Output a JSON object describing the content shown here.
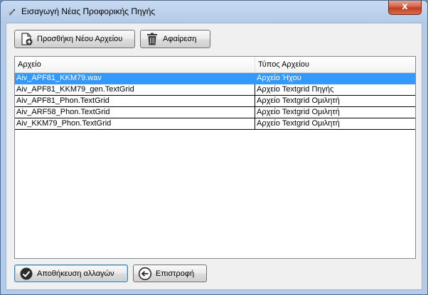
{
  "window": {
    "title": "Εισαγωγή Νέας Προφορικής Πηγής",
    "close_label": "x"
  },
  "toolbar": {
    "add_label": "Προσθήκη Νέου Αρχείου",
    "remove_label": "Αφαίρεση"
  },
  "table": {
    "columns": [
      "Αρχείο",
      "Τύπος Αρχείου"
    ],
    "rows": [
      {
        "file": "Aiv_APF81_KKM79.wav",
        "type": "Αρχείο Ήχου"
      },
      {
        "file": "Aiv_APF81_KKM79_gen.TextGrid",
        "type": "Αρχείο Textgrid Πηγής"
      },
      {
        "file": "Aiv_APF81_Phon.TextGrid",
        "type": "Αρχείο Textgrid Ομιλητή"
      },
      {
        "file": "Aiv_ARF58_Phon.TextGrid",
        "type": "Αρχείο Textgrid Ομιλητή"
      },
      {
        "file": "Aiv_KKM79_Phon.TextGrid",
        "type": "Αρχείο Textgrid Ομιλητή"
      }
    ],
    "selected_index": 0
  },
  "footer": {
    "save_label": "Αποθήκευση αλλαγών",
    "back_label": "Επιστροφή"
  },
  "colors": {
    "selection": "#3399ff",
    "titlebar": "#c9daf0",
    "close_button": "#c23a1d"
  },
  "icons": {
    "app": "app-icon",
    "add": "add-file-icon",
    "remove": "trash-icon",
    "save": "checkmark-icon",
    "back": "back-arrow-icon"
  }
}
